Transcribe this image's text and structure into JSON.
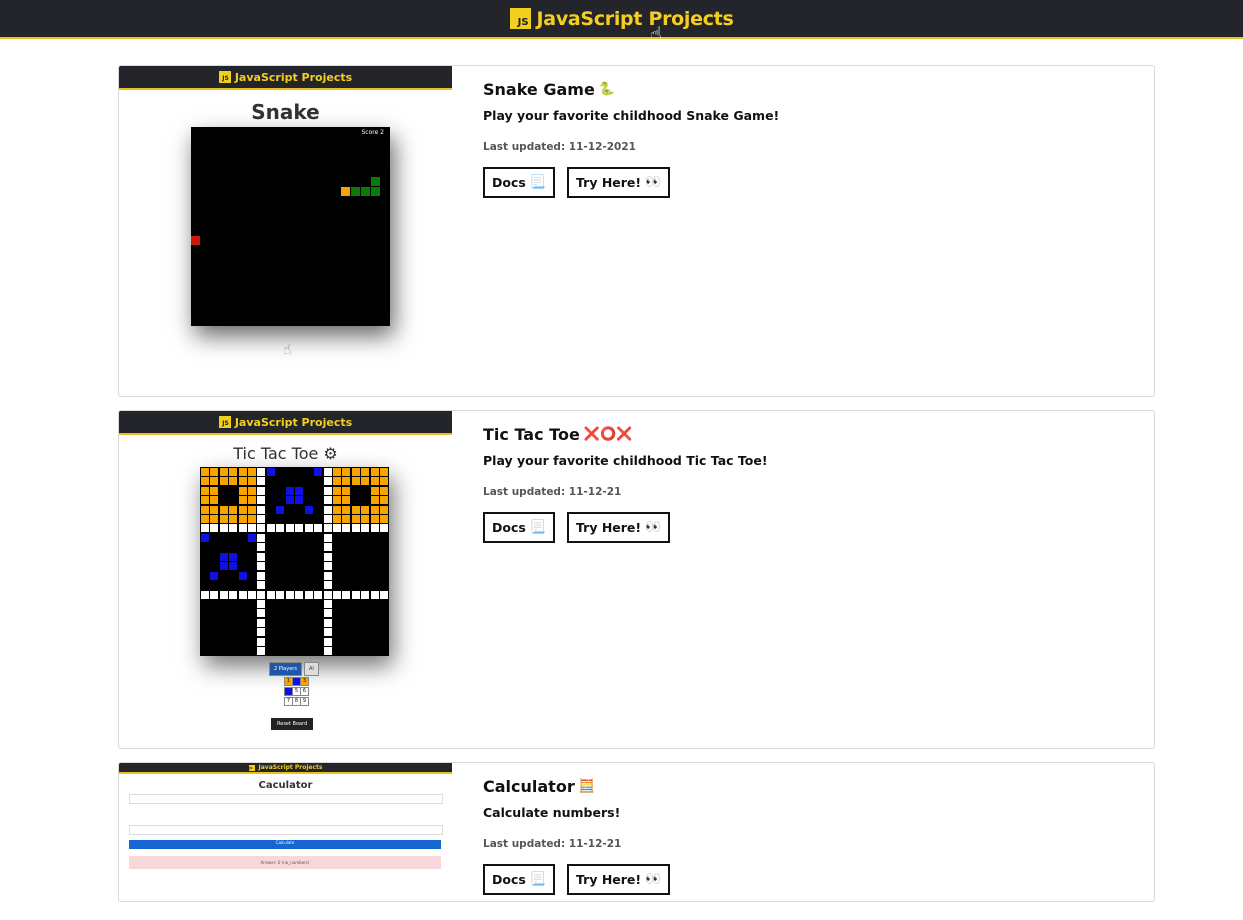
{
  "header": {
    "badge": "JS",
    "title": "JavaScript Projects"
  },
  "projects": [
    {
      "title": "Snake Game",
      "title_emoji": "🐍",
      "description": "Play your favorite childhood Snake Game!",
      "updated": "Last updated: 11-12-2021",
      "docs_label": "Docs",
      "docs_emoji": "📃",
      "try_label": "Try Here!",
      "try_emoji": "👀",
      "thumb": {
        "header": "JavaScript Projects",
        "badge": "JS",
        "game_title": "Snake",
        "score": "Score 2"
      }
    },
    {
      "title": "Tic Tac Toe",
      "title_emoji": "❌⭕❌",
      "description": "Play your favorite childhood Tic Tac Toe!",
      "updated": "Last updated: 11-12-21",
      "docs_label": "Docs",
      "docs_emoji": "📃",
      "try_label": "Try Here!",
      "try_emoji": "👀",
      "thumb": {
        "header": "JavaScript Projects",
        "badge": "JS",
        "game_title": "Tic Tac Toe ⚙",
        "mode_2p": "2 Players",
        "mode_ai": "AI",
        "reset": "Reset Board",
        "cells": [
          "1",
          "",
          "3",
          "",
          "5",
          "6",
          "7",
          "8",
          "9"
        ]
      }
    },
    {
      "title": "Calculator",
      "title_emoji": "🧮",
      "description": "Calculate numbers!",
      "updated": "Last updated: 11-12-21",
      "docs_label": "Docs",
      "docs_emoji": "📃",
      "try_label": "Try Here!",
      "try_emoji": "👀",
      "thumb": {
        "header": "JavaScript Projects",
        "badge": "JS",
        "app_title": "Caculator",
        "calc_btn": "Calculate",
        "alert": "Answer: 0 (no_numbers)"
      }
    }
  ],
  "colors": {
    "accent": "#f5cf1f",
    "header_bg": "#23252b",
    "snake": "#0a7a0a",
    "food": "#cc1a0a",
    "ttt_orange": "#f7a400",
    "ttt_blue": "#1010e0"
  }
}
